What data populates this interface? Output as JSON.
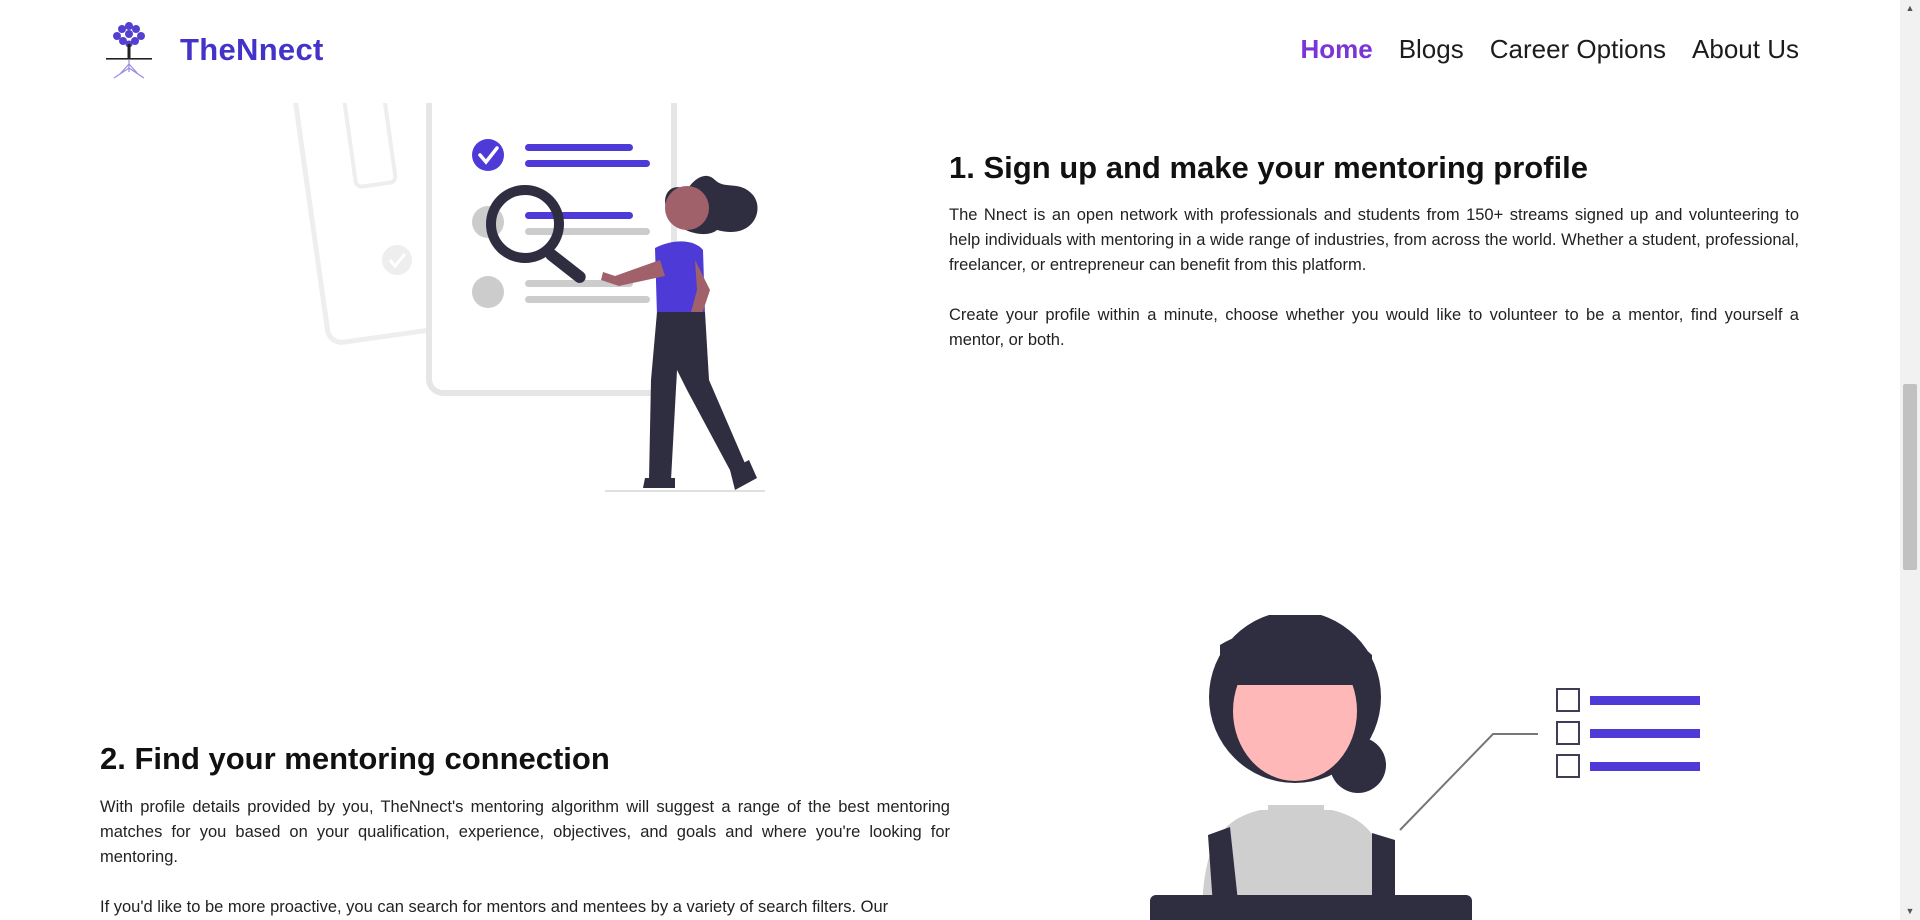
{
  "header": {
    "brand": "TheNnect",
    "logo_icon": "tree-icon",
    "nav": [
      {
        "label": "Home",
        "active": true
      },
      {
        "label": "Blogs",
        "active": false
      },
      {
        "label": "Career Options",
        "active": false
      },
      {
        "label": "About Us",
        "active": false
      }
    ]
  },
  "sections": [
    {
      "title": "1. Sign up and make your mentoring profile",
      "paragraphs": [
        "The Nnect is an open network with professionals and students from 150+ streams signed up and volunteering to help individuals with mentoring in a wide range of industries, from across the world. Whether a student, professional, freelancer, or entrepreneur can benefit from this platform.",
        "Create your profile within a minute, choose whether you would like to volunteer to be a mentor, find yourself a mentor, or both."
      ],
      "illustration": "profile-search-illustration"
    },
    {
      "title": "2. Find your mentoring connection",
      "paragraphs": [
        "With profile details provided by you, TheNnect's mentoring algorithm will suggest a range of the best mentoring matches for you based on your qualification, experience, objectives, and goals and where you're looking for mentoring.",
        "If you'd like to be more proactive, you can search for mentors and mentees by a variety of search filters. Our"
      ],
      "illustration": "checklist-person-illustration"
    }
  ],
  "colors": {
    "brand": "#4433c9",
    "nav_active": "#7a35d6",
    "accent": "#4e3ad6",
    "dark": "#2f2e41"
  }
}
